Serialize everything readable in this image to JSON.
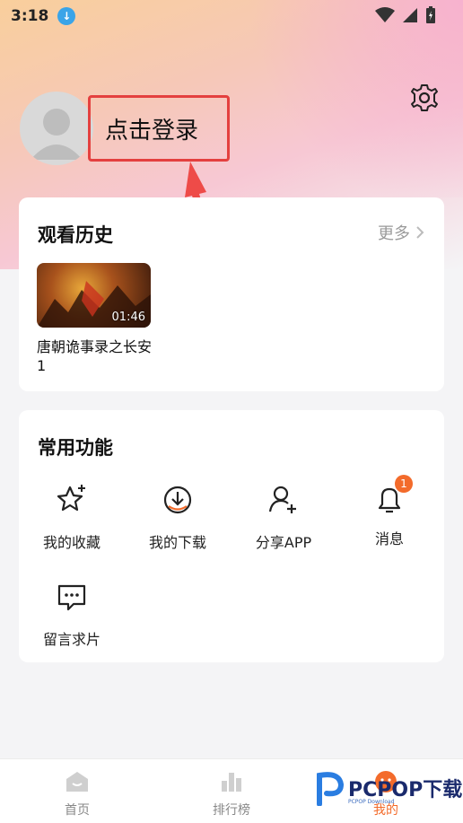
{
  "status_bar": {
    "time": "3:18"
  },
  "profile": {
    "login_label": "点击登录"
  },
  "history": {
    "title": "观看历史",
    "more_label": "更多",
    "items": [
      {
        "title": "唐朝诡事录之长安 1",
        "duration": "01:46"
      }
    ]
  },
  "functions": {
    "title": "常用功能",
    "items": [
      {
        "label": "我的收藏",
        "icon": "star-icon"
      },
      {
        "label": "我的下载",
        "icon": "download-icon"
      },
      {
        "label": "分享APP",
        "icon": "add-user-icon"
      },
      {
        "label": "消息",
        "icon": "bell-icon",
        "badge": "1"
      },
      {
        "label": "留言求片",
        "icon": "chat-icon"
      }
    ]
  },
  "bottom_nav": {
    "items": [
      {
        "label": "首页",
        "icon": "home-icon"
      },
      {
        "label": "排行榜",
        "icon": "chart-icon"
      },
      {
        "label": "我的",
        "icon": "profile-icon",
        "active": true
      }
    ]
  },
  "watermark": {
    "text": "PCPOP下载",
    "sub": "PCPOP Download"
  },
  "colors": {
    "accent": "#f36b2b",
    "highlight": "#e4403f"
  }
}
